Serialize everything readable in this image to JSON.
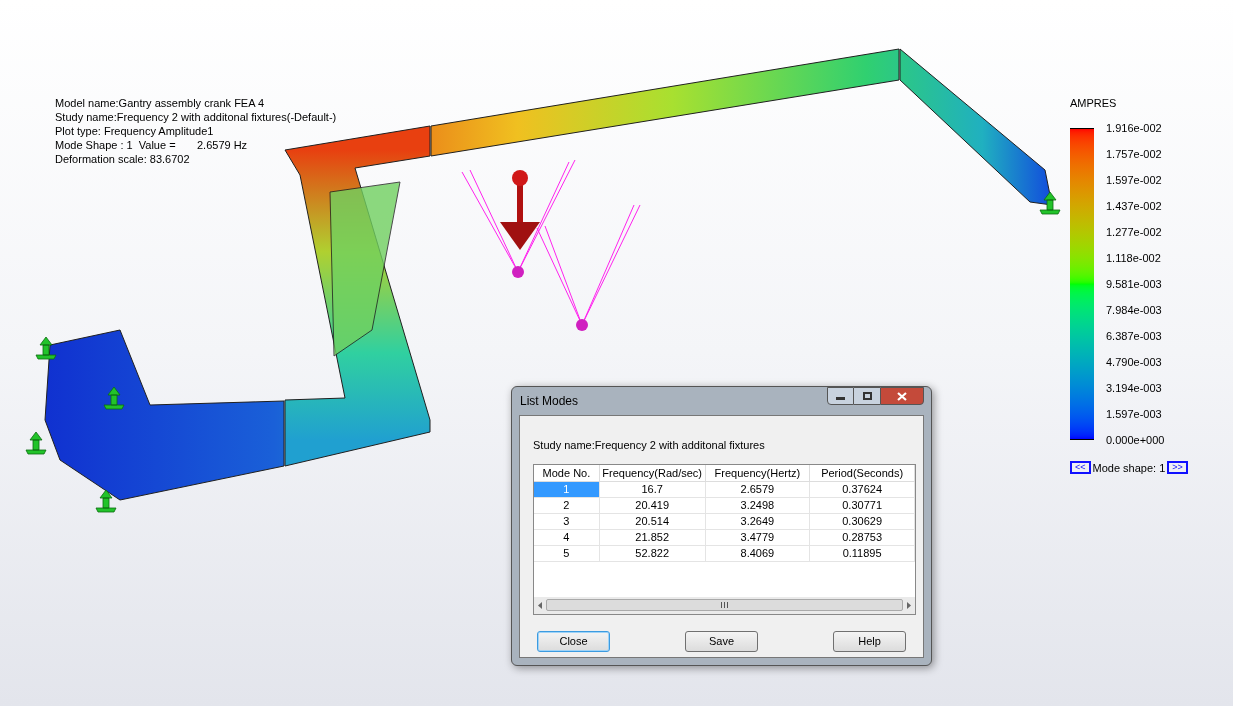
{
  "info": {
    "lines": [
      "Model name:Gantry assembly crank FEA 4",
      "Study name:Frequency 2 with additonal fixtures(-Default-)",
      "Plot type: Frequency Amplitude1",
      "Mode Shape : 1  Value =       2.6579 Hz",
      "Deformation scale: 83.6702"
    ]
  },
  "legend": {
    "title": "AMPRES",
    "labels": [
      "1.916e-002",
      "1.757e-002",
      "1.597e-002",
      "1.437e-002",
      "1.277e-002",
      "1.118e-002",
      "9.581e-003",
      "7.984e-003",
      "6.387e-003",
      "4.790e-003",
      "3.194e-003",
      "1.597e-003",
      "0.000e+000"
    ]
  },
  "mode_nav": {
    "prev": "<<",
    "label": "Mode shape: 1",
    "next": ">>"
  },
  "dialog": {
    "title": "List Modes",
    "study": "Study name:Frequency 2 with additonal fixtures",
    "columns": [
      "Mode No.",
      "Frequency(Rad/sec)",
      "Frequency(Hertz)",
      "Period(Seconds)"
    ],
    "rows": [
      {
        "selected": true,
        "cells": [
          "1",
          "16.7",
          "2.6579",
          "0.37624"
        ]
      },
      {
        "selected": false,
        "cells": [
          "2",
          "20.419",
          "3.2498",
          "0.30771"
        ]
      },
      {
        "selected": false,
        "cells": [
          "3",
          "20.514",
          "3.2649",
          "0.30629"
        ]
      },
      {
        "selected": false,
        "cells": [
          "4",
          "21.852",
          "3.4779",
          "0.28753"
        ]
      },
      {
        "selected": false,
        "cells": [
          "5",
          "52.822",
          "8.4069",
          "0.11895"
        ]
      }
    ],
    "buttons": [
      {
        "label": "Close",
        "focused": true
      },
      {
        "label": "Save",
        "focused": false
      },
      {
        "label": "Help",
        "focused": false
      }
    ]
  }
}
